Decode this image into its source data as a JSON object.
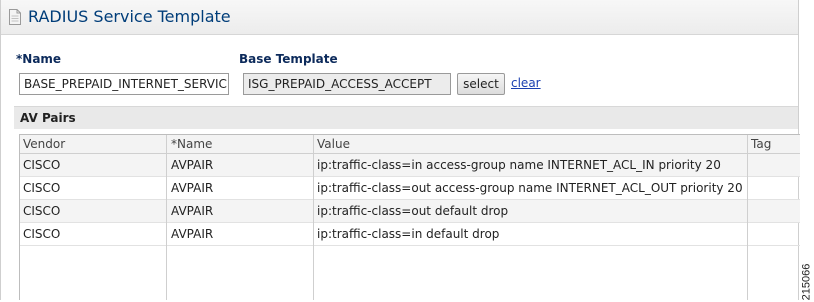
{
  "window": {
    "title": "RADIUS Service Template",
    "icon": "document-icon"
  },
  "form": {
    "name_label": "*Name",
    "name_value": "BASE_PREPAID_INTERNET_SERVICE",
    "base_template_label": "Base Template",
    "base_template_value": "ISG_PREPAID_ACCESS_ACCEPT",
    "select_label": "select",
    "clear_label": "clear"
  },
  "av_pairs": {
    "section_title": "AV Pairs",
    "columns": [
      "Vendor",
      "*Name",
      "Value",
      "Tag"
    ],
    "rows": [
      {
        "vendor": "CISCO",
        "name": "AVPAIR",
        "value": "ip:traffic-class=in access-group name INTERNET_ACL_IN priority 20",
        "tag": ""
      },
      {
        "vendor": "CISCO",
        "name": "AVPAIR",
        "value": "ip:traffic-class=out access-group name INTERNET_ACL_OUT priority 20",
        "tag": ""
      },
      {
        "vendor": "CISCO",
        "name": "AVPAIR",
        "value": "ip:traffic-class=out default drop",
        "tag": ""
      },
      {
        "vendor": "CISCO",
        "name": "AVPAIR",
        "value": "ip:traffic-class=in default drop",
        "tag": ""
      }
    ]
  },
  "figure_number": "215066"
}
